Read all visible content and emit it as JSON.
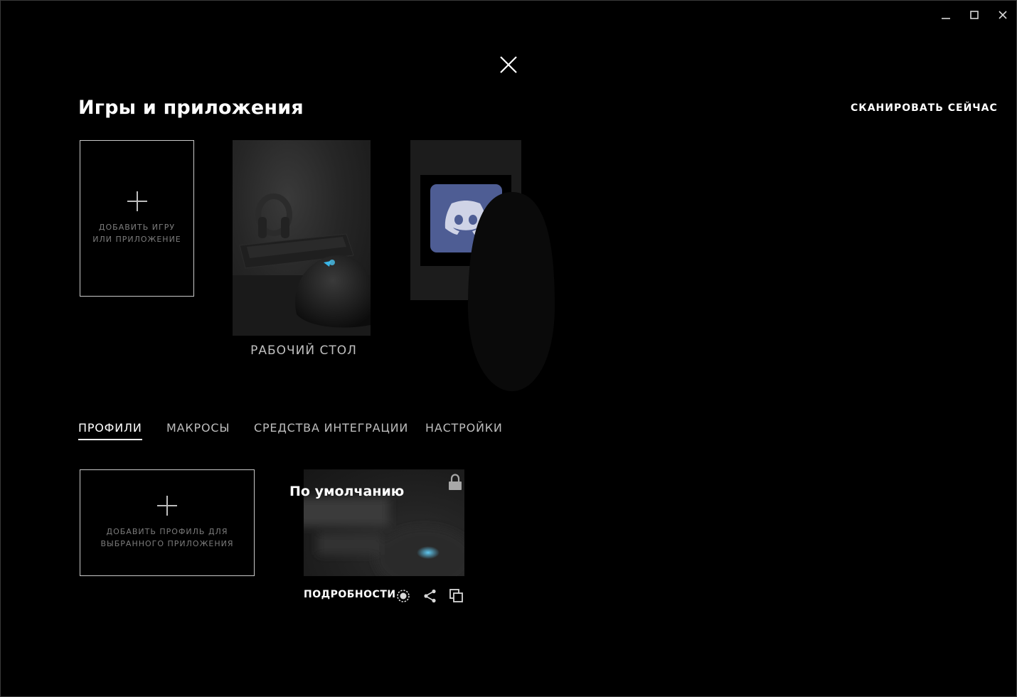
{
  "window": {
    "minimize_icon": "minimize-icon",
    "maximize_icon": "maximize-icon",
    "close_icon": "close-icon"
  },
  "overlay": {
    "close_icon": "close-x-icon"
  },
  "header": {
    "title": "Игры и приложения",
    "scan_label": "СКАНИРОВАТЬ СЕЙЧАС"
  },
  "apps": {
    "add_label": "ДОБАВИТЬ ИГРУ\nИЛИ ПРИЛОЖЕНИЕ",
    "items": [
      {
        "label": "РАБОЧИЙ СТОЛ",
        "icon": "desktop-mouse-image"
      },
      {
        "label": "",
        "icon": "discord-icon"
      }
    ]
  },
  "tabs": [
    {
      "label": "ПРОФИЛИ",
      "active": true
    },
    {
      "label": "МАКРОСЫ",
      "active": false
    },
    {
      "label": "СРЕДСТВА ИНТЕГРАЦИИ",
      "active": false
    },
    {
      "label": "НАСТРОЙКИ",
      "active": false
    }
  ],
  "profiles": {
    "add_label": "ДОБАВИТЬ ПРОФИЛЬ ДЛЯ\nВЫБРАННОГО ПРИЛОЖЕНИЯ",
    "items": [
      {
        "name": "По умолчанию",
        "details_label": "ПОДРОБНОСТИ",
        "locked": true
      }
    ]
  },
  "colors": {
    "background": "#000000",
    "text": "#ffffff",
    "muted": "#7c7c7c",
    "discord": "#4e5d94"
  }
}
